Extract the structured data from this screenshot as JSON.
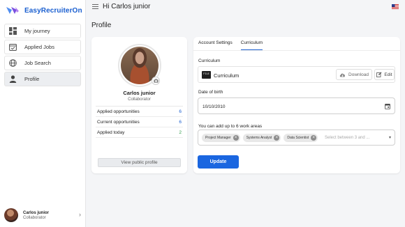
{
  "app": {
    "name": "EasyRecruiterOn"
  },
  "sidebar": {
    "items": [
      {
        "label": "My journey",
        "icon": "dashboard-icon"
      },
      {
        "label": "Applied Jobs",
        "icon": "calendar-check-icon"
      },
      {
        "label": "Job Search",
        "icon": "globe-icon"
      },
      {
        "label": "Profile",
        "icon": "person-icon",
        "active": true
      }
    ],
    "user": {
      "name": "Carlos junior",
      "role": "Collaborator"
    }
  },
  "header": {
    "greeting": "Hi Carlos junior",
    "flag": "us-flag-icon"
  },
  "page": {
    "title": "Profile"
  },
  "profile": {
    "name": "Carlos junior",
    "role": "Collaborator",
    "stats": [
      {
        "label": "Applied opportunities",
        "value": "6",
        "color": "#1a5fd0"
      },
      {
        "label": "Current opportunities",
        "value": "6",
        "color": "#1a5fd0"
      },
      {
        "label": "Applied today",
        "value": "2",
        "color": "#2e9b4a"
      }
    ],
    "view_button": "View public profile"
  },
  "tabs": [
    {
      "label": "Account Settings",
      "active": false
    },
    {
      "label": "Curriculum",
      "active": true
    }
  ],
  "curriculum": {
    "label": "Curriculum",
    "file_name": "Curriculum",
    "file_icon_text": "FILE",
    "download_label": "Download",
    "edit_label": "Edit"
  },
  "birth": {
    "label": "Date of birth",
    "value": "10/10/2010"
  },
  "work_areas": {
    "label": "You can add up to 6 work areas",
    "chips": [
      "Project Manager",
      "Systems Analyst",
      "Data Scientist"
    ],
    "placeholder": "Select between 3 and ..."
  },
  "update_button": "Update",
  "colors": {
    "accent": "#1a66e0",
    "brand": "#1a5fd0"
  }
}
